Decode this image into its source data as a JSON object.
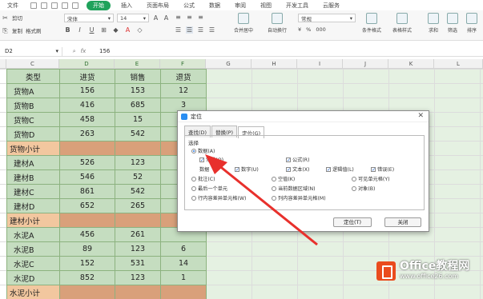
{
  "menubar": {
    "file": "文件",
    "tabs": [
      "开始",
      "插入",
      "页面布局",
      "公式",
      "数据",
      "审阅",
      "视图",
      "开发工具",
      "云服务"
    ],
    "active": "开始"
  },
  "toolbar": {
    "cut": "剪切",
    "paste": "粘贴",
    "copy": "复制",
    "format_painter": "格式刷",
    "font_name": "宋体",
    "font_size": "14",
    "bold": "B",
    "italic": "I",
    "underline": "U",
    "merge_center": "合并居中",
    "wrap_text": "自动换行",
    "number_format": "常规",
    "currency": "¥",
    "percent": "%",
    "thousands": "000",
    "cond_format": "条件格式",
    "table_style": "表格样式",
    "sum": "求和",
    "filter": "筛选",
    "sort": "排序"
  },
  "formula_bar": {
    "cell_ref": "D2",
    "fx": "fx",
    "value": "156"
  },
  "columns": [
    "C",
    "D",
    "E",
    "F",
    "G",
    "H",
    "I",
    "J",
    "K",
    "L"
  ],
  "sheet": {
    "header": [
      "类型",
      "进货",
      "销售",
      "退货"
    ],
    "rows": [
      {
        "kind": "row",
        "cells": [
          "货物A",
          "156",
          "153",
          "12"
        ]
      },
      {
        "kind": "row",
        "cells": [
          "货物B",
          "416",
          "685",
          "3"
        ]
      },
      {
        "kind": "row",
        "cells": [
          "货物C",
          "458",
          "15",
          ""
        ]
      },
      {
        "kind": "row",
        "cells": [
          "货物D",
          "263",
          "542",
          ""
        ]
      },
      {
        "kind": "sub",
        "cells": [
          "货物小计",
          "",
          "",
          ""
        ]
      },
      {
        "kind": "row",
        "cells": [
          "建材A",
          "526",
          "123",
          ""
        ]
      },
      {
        "kind": "row",
        "cells": [
          "建材B",
          "546",
          "52",
          ""
        ]
      },
      {
        "kind": "row",
        "cells": [
          "建材C",
          "861",
          "542",
          ""
        ]
      },
      {
        "kind": "row",
        "cells": [
          "建材D",
          "652",
          "265",
          ""
        ]
      },
      {
        "kind": "sub",
        "cells": [
          "建材小计",
          "",
          "",
          ""
        ]
      },
      {
        "kind": "row",
        "cells": [
          "水泥A",
          "456",
          "261",
          ""
        ]
      },
      {
        "kind": "row",
        "cells": [
          "水泥B",
          "89",
          "123",
          "6"
        ]
      },
      {
        "kind": "row",
        "cells": [
          "水泥C",
          "152",
          "531",
          "14"
        ]
      },
      {
        "kind": "row",
        "cells": [
          "水泥D",
          "852",
          "123",
          "1"
        ]
      },
      {
        "kind": "sub",
        "cells": [
          "水泥小计",
          "",
          "",
          ""
        ]
      }
    ]
  },
  "dialog": {
    "title": "定位",
    "tabs": [
      "查找(D)",
      "替换(P)",
      "定位(G)"
    ],
    "active_tab": "定位(G)",
    "section": "选择",
    "data_option": "数据(A)",
    "constant": "常量(O)",
    "formula": "公式(R)",
    "data_type_label": "数据",
    "number": "数字(U)",
    "text": "文本(X)",
    "logical": "逻辑值(L)",
    "error": "错误(E)",
    "comment": "批注(C)",
    "blank": "空值(K)",
    "visible_cells": "可见单元格(Y)",
    "last_cell": "最后一个单元",
    "current_region": "当前数据区域(N)",
    "objects": "对象(B)",
    "row_diff": "行内容差异单元格(W)",
    "col_diff": "列内容差异单元格(M)",
    "goto_button": "定位(T)",
    "close_button": "关闭"
  },
  "watermark": {
    "brand": "Office教程网",
    "url": "www.office26.com"
  },
  "colors": {
    "accent": "#1fa25b",
    "cell_green": "#c5ddc0",
    "subtotal_orange": "#f2c79f",
    "arrow_red": "#e8302c"
  }
}
